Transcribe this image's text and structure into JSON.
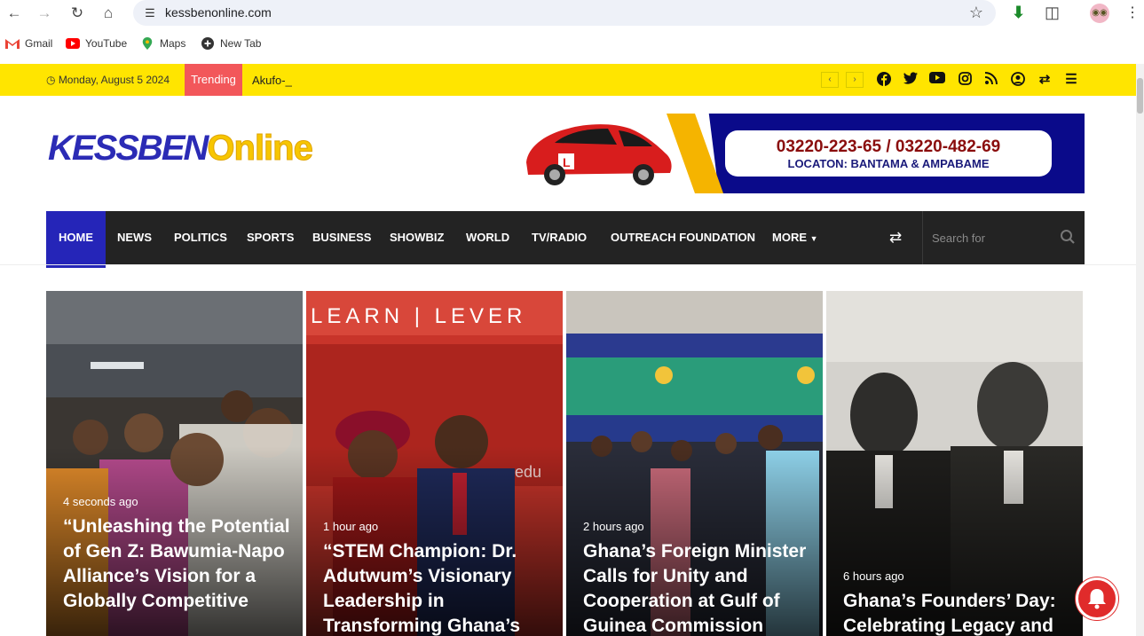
{
  "browser": {
    "url": "kessbenonline.com",
    "bookmarks": [
      {
        "label": "Gmail",
        "icon": "gmail-icon"
      },
      {
        "label": "YouTube",
        "icon": "youtube-icon"
      },
      {
        "label": "Maps",
        "icon": "maps-icon"
      },
      {
        "label": "New Tab",
        "icon": "new-tab-icon"
      }
    ]
  },
  "topbar": {
    "date": "Monday, August 5 2024",
    "trending_label": "Trending",
    "ticker_text": "Akufo-_"
  },
  "header": {
    "logo_part1": "KESSBEN",
    "logo_part2": "Online",
    "banner_phone": "03220-223-65 / 03220-482-69",
    "banner_location": "LOCATON: BANTAMA & AMPABAME"
  },
  "nav": {
    "items": [
      "HOME",
      "NEWS",
      "POLITICS",
      "SPORTS",
      "BUSINESS",
      "SHOWBIZ",
      "WORLD",
      "TV/RADIO",
      "OUTREACH FOUNDATION",
      "MORE"
    ],
    "search_placeholder": "Search for"
  },
  "cards": [
    {
      "time": "4 seconds ago",
      "title": "“Unleashing the Potential of Gen Z: Bawumia-Napo Alliance’s Vision for a Globally Competitive"
    },
    {
      "time": "1 hour ago",
      "title": "“STEM Champion: Dr. Adutwum’s Visionary Leadership in Transforming Ghana’s"
    },
    {
      "time": "2 hours ago",
      "title": "Ghana’s Foreign Minister Calls for Unity and Cooperation at Gulf of Guinea Commission"
    },
    {
      "time": "6 hours ago",
      "title": "Ghana’s Founders’ Day: Celebrating Legacy and"
    }
  ],
  "colors": {
    "topbar": "#ffe500",
    "trending": "#f2575a",
    "nav_bg": "#232323",
    "nav_active": "#2525b8"
  }
}
